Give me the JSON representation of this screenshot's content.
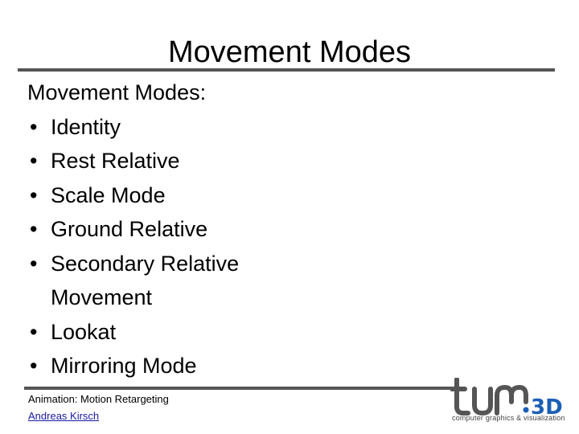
{
  "slide": {
    "title": "Movement Modes",
    "heading": "Movement Modes:",
    "bullet_glyph": "•",
    "bullets": [
      "Identity",
      "Rest Relative",
      "Scale Mode",
      "Ground Relative",
      "Secondary Relative Movement",
      "Lookat",
      "Mirroring Mode"
    ]
  },
  "footer": {
    "course": "Animation: Motion Retargeting",
    "author": "Andreas Kirsch",
    "logo": {
      "wordmark": "tum",
      "suffix": ".3D",
      "tagline": "computer graphics & visualization",
      "colors": {
        "wordmark": "#555555",
        "suffix": "#1a5fb4"
      }
    }
  }
}
